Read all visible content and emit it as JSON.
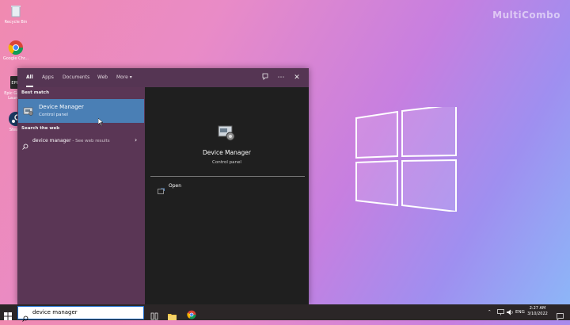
{
  "watermark": "MultiCombo",
  "desktop": {
    "icons": [
      {
        "label": "Recycle Bin"
      },
      {
        "label": "Google Chr..."
      },
      {
        "label": "Epic Games Launc..."
      },
      {
        "label": "Steam"
      }
    ]
  },
  "search": {
    "tabs": [
      "All",
      "Apps",
      "Documents",
      "Web",
      "More"
    ],
    "best_match_label": "Best match",
    "best_title": "Device Manager",
    "best_sub": "Control panel",
    "web_label": "Search the web",
    "web_query": "device manager",
    "web_see": " - See web results",
    "detail_title": "Device Manager",
    "detail_sub": "Control panel",
    "open_label": "Open"
  },
  "taskbar": {
    "search_value": "device manager",
    "lang": "ENG",
    "time": "2:27 AM",
    "date": "3/10/2022"
  },
  "colors": {
    "accent": "#4a7fb5",
    "menu_left": "#5a3655",
    "menu_top": "#553553"
  }
}
